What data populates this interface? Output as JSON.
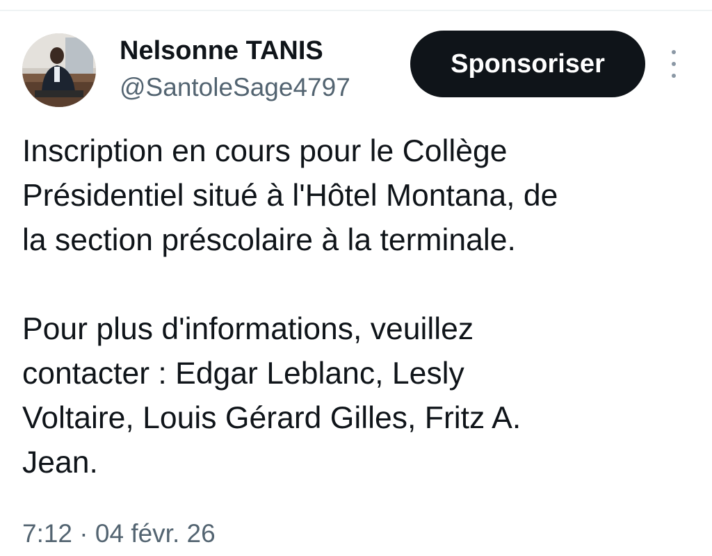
{
  "author": {
    "display_name": "Nelsonne TANIS",
    "handle": "@SantoleSage4797"
  },
  "actions": {
    "sponsor_label": "Sponsoriser",
    "more_icon": "vertical-ellipsis-icon"
  },
  "tweet": {
    "paragraph_1": [
      "Inscription en cours pour le Collège",
      "Présidentiel situé à l'Hôtel Montana, de",
      "la section préscolaire à la terminale."
    ],
    "paragraph_2": [
      "Pour plus d'informations, veuillez",
      "contacter : Edgar Leblanc, Lesly",
      "Voltaire, Louis Gérard Gilles, Fritz A.",
      "Jean."
    ],
    "timestamp": "7:12 · 04 févr. 26"
  },
  "colors": {
    "text_primary": "#0f1419",
    "text_secondary": "#536471",
    "button_bg": "#0f1419",
    "button_text": "#ffffff"
  }
}
